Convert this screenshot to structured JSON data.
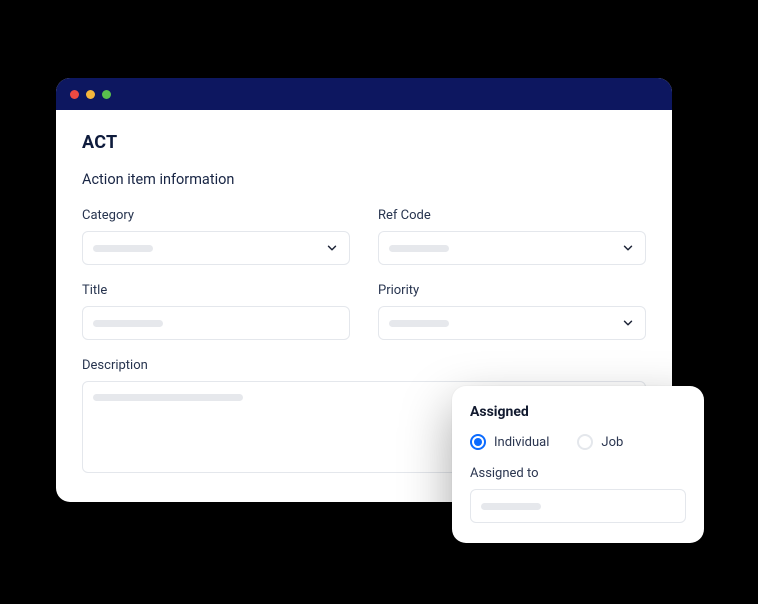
{
  "page": {
    "title": "ACT",
    "section_title": "Action item information"
  },
  "form": {
    "category_label": "Category",
    "refcode_label": "Ref Code",
    "title_label": "Title",
    "priority_label": "Priority",
    "description_label": "Description"
  },
  "popup": {
    "title": "Assigned",
    "option_individual": "Individual",
    "option_job": "Job",
    "assigned_to_label": "Assigned to"
  }
}
